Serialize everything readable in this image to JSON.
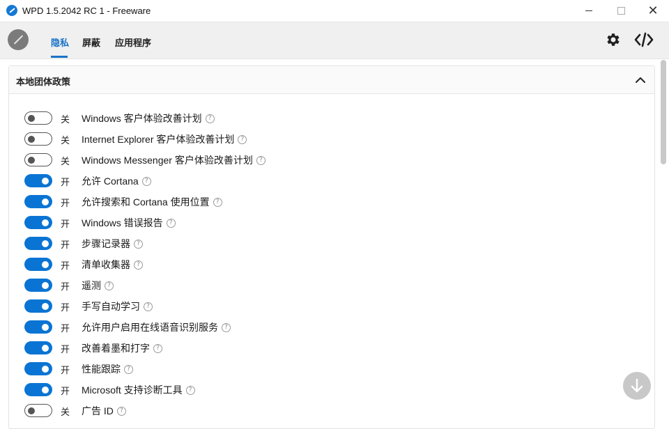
{
  "window": {
    "title": "WPD 1.5.2042 RC 1 - Freeware"
  },
  "tabs": [
    {
      "label": "隐私",
      "active": true
    },
    {
      "label": "屏蔽",
      "active": false
    },
    {
      "label": "应用程序",
      "active": false
    }
  ],
  "panel": {
    "title": "本地团体政策"
  },
  "help_glyph": "?",
  "rows": [
    {
      "state": "关",
      "on": false,
      "label": "Windows 客户体验改善计划"
    },
    {
      "state": "关",
      "on": false,
      "label": "Internet Explorer 客户体验改善计划"
    },
    {
      "state": "关",
      "on": false,
      "label": "Windows Messenger 客户体验改善计划"
    },
    {
      "state": "开",
      "on": true,
      "label": "允许 Cortana"
    },
    {
      "state": "开",
      "on": true,
      "label": "允许搜索和 Cortana 使用位置"
    },
    {
      "state": "开",
      "on": true,
      "label": "Windows 错误报告"
    },
    {
      "state": "开",
      "on": true,
      "label": "步骤记录器"
    },
    {
      "state": "开",
      "on": true,
      "label": "清单收集器"
    },
    {
      "state": "开",
      "on": true,
      "label": "遥测"
    },
    {
      "state": "开",
      "on": true,
      "label": "手写自动学习"
    },
    {
      "state": "开",
      "on": true,
      "label": "允许用户启用在线语音识别服务"
    },
    {
      "state": "开",
      "on": true,
      "label": "改善着墨和打字"
    },
    {
      "state": "开",
      "on": true,
      "label": "性能跟踪"
    },
    {
      "state": "开",
      "on": true,
      "label": "Microsoft 支持诊断工具"
    },
    {
      "state": "关",
      "on": false,
      "label": "广告 ID"
    }
  ],
  "colors": {
    "accent": "#0a74d4",
    "tab_active": "#1a73c8"
  },
  "icons": {
    "app": "wpd-logo-icon",
    "settings": "gear-icon",
    "code": "code-icon",
    "collapse": "chevron-up-icon",
    "scroll": "arrow-down-icon",
    "help": "help-icon"
  }
}
